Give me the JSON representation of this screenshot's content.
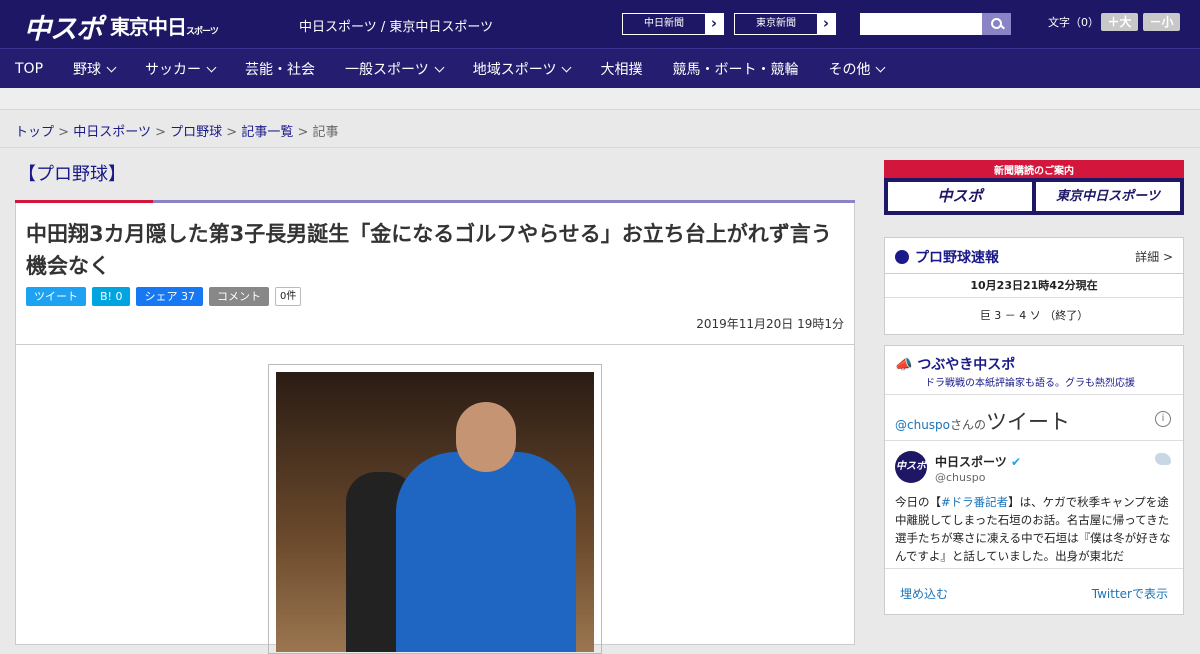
{
  "header": {
    "logo_chuspo": "中スポ",
    "logo_tokyo": "東京中日",
    "logo_tokyo_sub": "スポーツ",
    "site_name": "中日スポーツ / 東京中日スポーツ",
    "btn_chunichi": "中日新聞",
    "btn_tokyo": "東京新聞",
    "arrow": "›",
    "font_size_label": "文字（0）",
    "font_up": "＋大",
    "font_down": "－小"
  },
  "nav": [
    "TOP",
    "野球",
    "サッカー",
    "芸能・社会",
    "一般スポーツ",
    "地域スポーツ",
    "大相撲",
    "競馬・ボート・競輪",
    "その他"
  ],
  "breadcrumb": {
    "top": "トップ",
    "chunichi": "中日スポーツ",
    "pro": "プロ野球",
    "list": "記事一覧",
    "current": "記事",
    "sep": ">"
  },
  "article": {
    "category": "【プロ野球】",
    "title": "中田翔3カ月隠した第3子長男誕生「金になるゴルフやらせる」お立ち台上がれず言う機会なく",
    "tweet": "ツイート",
    "hatena": "B! 0",
    "facebook": "シェア 37",
    "comment": "コメント",
    "comment_count": "0件",
    "date": "2019年11月20日 19時1分"
  },
  "sidebar": {
    "promo_title": "新聞購読のご案内",
    "promo_chuspo": "中スポ",
    "promo_tokyo": "東京中日スポーツ",
    "scores_title": "プロ野球速報",
    "scores_detail": "詳細 >",
    "scores_time": "10月23日21時42分現在",
    "score_line": "巨 3 － 4 ソ （終了）",
    "tw_title": "つぶやき中スポ",
    "tw_sub": "ドラ戦戦の本紙評論家も語る。グラも熱烈応援",
    "tw_handle_prefix": "@chuspo",
    "tw_handle_suffix": "さんの",
    "tw_header": "ツイート",
    "tw_name": "中日スポーツ",
    "tw_user": "@chuspo",
    "tw_av": "中スポ",
    "tweet_pre": "今日の【",
    "tweet_tag": "#ドラ番記者",
    "tweet_body": "】は、ケガで秋季キャンプを途中離脱してしまった石垣のお話。名古屋に帰ってきた選手たちが寒さに凍える中で石垣は『僕は冬が好きなんですよ』と話していました。出身が東北だ",
    "embed": "埋め込む",
    "view_on_twitter": "Twitterで表示"
  },
  "colors": {
    "header_bg": "#1e1766",
    "accent_red": "#d3163c",
    "twitter": "#1da1f2",
    "facebook": "#1877f2",
    "hatena": "#00a4de"
  }
}
